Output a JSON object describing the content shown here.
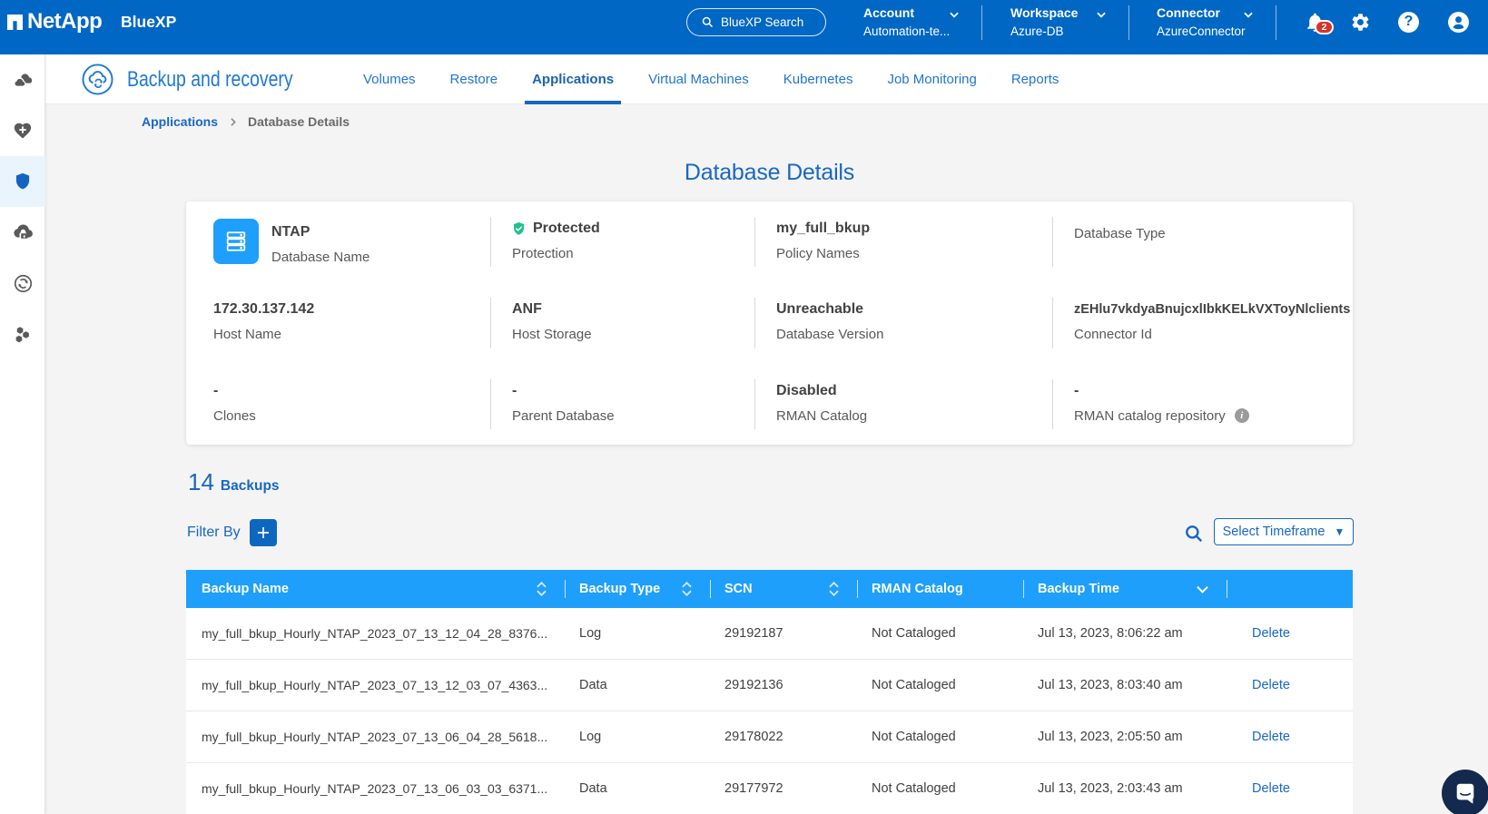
{
  "topbar": {
    "brand": "NetApp",
    "product": "BlueXP",
    "search_label": "BlueXP Search",
    "menus": [
      {
        "label": "Account",
        "value": "Automation-te..."
      },
      {
        "label": "Workspace",
        "value": "Azure-DB"
      },
      {
        "label": "Connector",
        "value": "AzureConnector"
      }
    ],
    "notification_count": "2",
    "help_glyph": "?"
  },
  "sidebar": {
    "items": [
      {
        "icon": "clouds-icon",
        "active": false
      },
      {
        "icon": "health-heart-icon",
        "active": false
      },
      {
        "icon": "shield-icon",
        "active": true
      },
      {
        "icon": "cloud-lock-icon",
        "active": false
      },
      {
        "icon": "sync-icon",
        "active": false
      },
      {
        "icon": "hexagons-icon",
        "active": false
      }
    ]
  },
  "header": {
    "app_title": "Backup and recovery",
    "tabs": [
      {
        "label": "Volumes"
      },
      {
        "label": "Restore"
      },
      {
        "label": "Applications"
      },
      {
        "label": "Virtual Machines"
      },
      {
        "label": "Kubernetes"
      },
      {
        "label": "Job Monitoring"
      },
      {
        "label": "Reports"
      }
    ],
    "active_tab": "Applications"
  },
  "breadcrumb": {
    "parent": "Applications",
    "current": "Database Details"
  },
  "page": {
    "title": "Database Details"
  },
  "details_card": {
    "info_glyph": "i",
    "fields": [
      {
        "value": "NTAP",
        "label": "Database Name"
      },
      {
        "value": "Protected",
        "label": "Protection"
      },
      {
        "value": "my_full_bkup",
        "label": "Policy Names"
      },
      {
        "value": "",
        "label": "Database Type"
      },
      {
        "value": "172.30.137.142",
        "label": "Host Name"
      },
      {
        "value": "ANF",
        "label": "Host Storage"
      },
      {
        "value": "Unreachable",
        "label": "Database Version"
      },
      {
        "value": "zEHlu7vkdyaBnujcxlIbkKELkVXToyNlclients",
        "label": "Connector Id"
      },
      {
        "value": "-",
        "label": "Clones"
      },
      {
        "value": "-",
        "label": "Parent Database"
      },
      {
        "value": "Disabled",
        "label": "RMAN Catalog"
      },
      {
        "value": "-",
        "label": "RMAN catalog repository"
      }
    ]
  },
  "backups": {
    "count": "14",
    "count_label": "Backups",
    "filter_label": "Filter By",
    "timeframe_button": "Select Timeframe",
    "timeframe_caret": "▼"
  },
  "table": {
    "headers": [
      "Backup Name",
      "Backup Type",
      "SCN",
      "RMAN Catalog",
      "Backup Time"
    ],
    "rows": [
      {
        "name": "my_full_bkup_Hourly_NTAP_2023_07_13_12_04_28_8376...",
        "type": "Log",
        "scn": "29192187",
        "catalog": "Not Cataloged",
        "time": "Jul 13, 2023, 8:06:22 am",
        "action": "Delete"
      },
      {
        "name": "my_full_bkup_Hourly_NTAP_2023_07_13_12_03_07_4363...",
        "type": "Data",
        "scn": "29192136",
        "catalog": "Not Cataloged",
        "time": "Jul 13, 2023, 8:03:40 am",
        "action": "Delete"
      },
      {
        "name": "my_full_bkup_Hourly_NTAP_2023_07_13_06_04_28_5618...",
        "type": "Log",
        "scn": "29178022",
        "catalog": "Not Cataloged",
        "time": "Jul 13, 2023, 2:05:50 am",
        "action": "Delete"
      },
      {
        "name": "my_full_bkup_Hourly_NTAP_2023_07_13_06_03_03_6371...",
        "type": "Data",
        "scn": "29177972",
        "catalog": "Not Cataloged",
        "time": "Jul 13, 2023, 2:03:43 am",
        "action": "Delete"
      }
    ]
  },
  "colors": {
    "topbar_blue": "#0067C5",
    "table_header_blue": "#1E9FFC",
    "link_blue": "#1767C9",
    "protected_green": "#21C08C",
    "notification_red": "#D8332A",
    "chat_navy": "#14294E",
    "page_background": "#F4F4F4"
  }
}
